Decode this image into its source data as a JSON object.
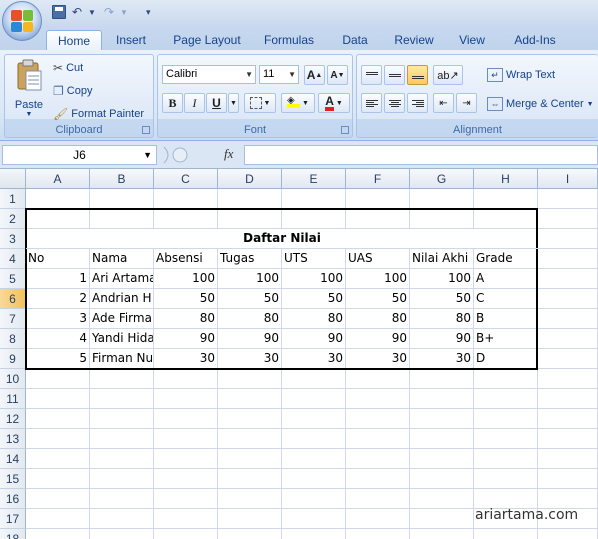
{
  "tabs": [
    "Home",
    "Insert",
    "Page Layout",
    "Formulas",
    "Data",
    "Review",
    "View",
    "Add-Ins"
  ],
  "clipboard": {
    "group_label": "Clipboard",
    "paste": "Paste",
    "cut": "Cut",
    "copy": "Copy",
    "format_painter": "Format Painter"
  },
  "font": {
    "group_label": "Font",
    "name": "Calibri",
    "size": "11",
    "bold": "B",
    "italic": "I",
    "underline": "U",
    "font_color_letter": "A"
  },
  "alignment": {
    "group_label": "Alignment",
    "wrap_text": "Wrap Text",
    "merge_center": "Merge & Center"
  },
  "formula_bar": {
    "name_box": "J6",
    "fx": "fx",
    "formula": ""
  },
  "columns": [
    "A",
    "B",
    "C",
    "D",
    "E",
    "F",
    "G",
    "H",
    "I"
  ],
  "rows": [
    "1",
    "2",
    "3",
    "4",
    "5",
    "6",
    "7",
    "8",
    "9",
    "10",
    "11",
    "12",
    "13",
    "14",
    "15",
    "16",
    "17",
    "18"
  ],
  "sheet": {
    "title": "Daftar Nilai",
    "headers": [
      "No",
      "Nama",
      "Absensi",
      "Tugas",
      "UTS",
      "UAS",
      "Nilai Akhi",
      "Grade"
    ],
    "records": [
      [
        "1",
        "Ari Artama",
        "100",
        "100",
        "100",
        "100",
        "100",
        "A"
      ],
      [
        "2",
        "Andrian H",
        "50",
        "50",
        "50",
        "50",
        "50",
        "C"
      ],
      [
        "3",
        "Ade Firma",
        "80",
        "80",
        "80",
        "80",
        "80",
        "B"
      ],
      [
        "4",
        "Yandi Hida",
        "90",
        "90",
        "90",
        "90",
        "90",
        "B+"
      ],
      [
        "5",
        "Firman Nu",
        "30",
        "30",
        "30",
        "30",
        "30",
        "D"
      ]
    ]
  },
  "watermark": "ariartama.com",
  "colors": {
    "accent": "#15428b",
    "ribbon_bg": "#dbe7f6",
    "grid_line": "#d0d7e5"
  }
}
